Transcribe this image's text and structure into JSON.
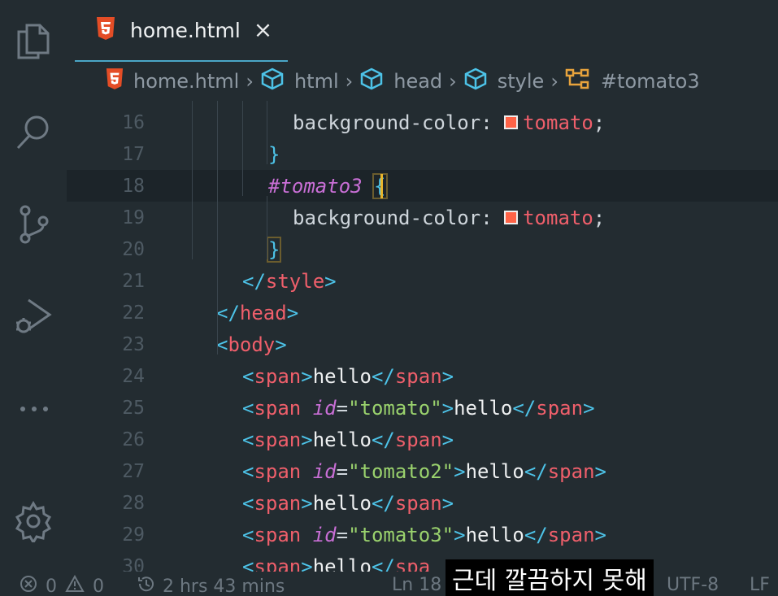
{
  "tab": {
    "filename": "home.html",
    "close_glyph": "×"
  },
  "breadcrumb": {
    "items": [
      "home.html",
      "html",
      "head",
      "style",
      "#tomato3"
    ],
    "separator": "›"
  },
  "editor": {
    "lines": [
      {
        "n": "16",
        "segments": [
          [
            "prop",
            "background-color"
          ],
          [
            "punc",
            ": "
          ],
          [
            "swatch",
            ""
          ],
          [
            "val",
            "tomato"
          ],
          [
            "punc",
            ";"
          ]
        ]
      },
      {
        "n": "17",
        "segments": [
          [
            "br",
            "}"
          ]
        ]
      },
      {
        "n": "18",
        "segments": [
          [
            "sel",
            "#tomato3"
          ],
          [
            "punc",
            " "
          ],
          [
            "brmatch",
            "{"
          ]
        ]
      },
      {
        "n": "19",
        "segments": [
          [
            "prop",
            "background-color"
          ],
          [
            "punc",
            ": "
          ],
          [
            "swatch",
            ""
          ],
          [
            "val",
            "tomato"
          ],
          [
            "punc",
            ";"
          ]
        ]
      },
      {
        "n": "20",
        "segments": [
          [
            "brmatch",
            "}"
          ]
        ]
      },
      {
        "n": "21",
        "segments": [
          [
            "br",
            "</"
          ],
          [
            "tag",
            "style"
          ],
          [
            "br",
            ">"
          ]
        ]
      },
      {
        "n": "22",
        "segments": [
          [
            "br",
            "</"
          ],
          [
            "tag",
            "head"
          ],
          [
            "br",
            ">"
          ]
        ]
      },
      {
        "n": "23",
        "segments": [
          [
            "br",
            "<"
          ],
          [
            "tag",
            "body"
          ],
          [
            "br",
            ">"
          ]
        ]
      },
      {
        "n": "24",
        "segments": [
          [
            "br",
            "<"
          ],
          [
            "tag",
            "span"
          ],
          [
            "br",
            ">"
          ],
          [
            "txt",
            "hello"
          ],
          [
            "br",
            "</"
          ],
          [
            "tag",
            "span"
          ],
          [
            "br",
            ">"
          ]
        ]
      },
      {
        "n": "25",
        "segments": [
          [
            "br",
            "<"
          ],
          [
            "tag",
            "span"
          ],
          [
            "punc",
            " "
          ],
          [
            "attr",
            "id"
          ],
          [
            "punc",
            "="
          ],
          [
            "str",
            "\"tomato\""
          ],
          [
            "br",
            ">"
          ],
          [
            "txt",
            "hello"
          ],
          [
            "br",
            "</"
          ],
          [
            "tag",
            "span"
          ],
          [
            "br",
            ">"
          ]
        ]
      },
      {
        "n": "26",
        "segments": [
          [
            "br",
            "<"
          ],
          [
            "tag",
            "span"
          ],
          [
            "br",
            ">"
          ],
          [
            "txt",
            "hello"
          ],
          [
            "br",
            "</"
          ],
          [
            "tag",
            "span"
          ],
          [
            "br",
            ">"
          ]
        ]
      },
      {
        "n": "27",
        "segments": [
          [
            "br",
            "<"
          ],
          [
            "tag",
            "span"
          ],
          [
            "punc",
            " "
          ],
          [
            "attr",
            "id"
          ],
          [
            "punc",
            "="
          ],
          [
            "str",
            "\"tomato2\""
          ],
          [
            "br",
            ">"
          ],
          [
            "txt",
            "hello"
          ],
          [
            "br",
            "</"
          ],
          [
            "tag",
            "span"
          ],
          [
            "br",
            ">"
          ]
        ]
      },
      {
        "n": "28",
        "segments": [
          [
            "br",
            "<"
          ],
          [
            "tag",
            "span"
          ],
          [
            "br",
            ">"
          ],
          [
            "txt",
            "hello"
          ],
          [
            "br",
            "</"
          ],
          [
            "tag",
            "span"
          ],
          [
            "br",
            ">"
          ]
        ]
      },
      {
        "n": "29",
        "segments": [
          [
            "br",
            "<"
          ],
          [
            "tag",
            "span"
          ],
          [
            "punc",
            " "
          ],
          [
            "attr",
            "id"
          ],
          [
            "punc",
            "="
          ],
          [
            "str",
            "\"tomato3\""
          ],
          [
            "br",
            ">"
          ],
          [
            "txt",
            "hello"
          ],
          [
            "br",
            "</"
          ],
          [
            "tag",
            "span"
          ],
          [
            "br",
            ">"
          ]
        ]
      },
      {
        "n": "30",
        "segments": [
          [
            "br",
            "<"
          ],
          [
            "tag",
            "span"
          ],
          [
            "br",
            ">"
          ],
          [
            "txt",
            "hello"
          ],
          [
            "br",
            "</"
          ],
          [
            "tag",
            "spa"
          ]
        ]
      }
    ]
  },
  "statusbar": {
    "errors": "0",
    "warnings": "0",
    "time": "2 hrs 43 mins",
    "position": "Ln 18",
    "encoding": "UTF-8",
    "eol": "LF"
  },
  "subtitle": "근데 깔끔하지 못해",
  "colors": {
    "background": "#232c31",
    "accent": "#4aa6c7",
    "tomato": "#ff6347"
  },
  "icons": [
    "explorer-icon",
    "search-icon",
    "source-control-icon",
    "run-debug-icon",
    "more-icon",
    "settings-icon",
    "html5-icon",
    "close-icon",
    "symbol-icon",
    "selector-icon",
    "error-icon",
    "warning-icon",
    "history-icon"
  ]
}
